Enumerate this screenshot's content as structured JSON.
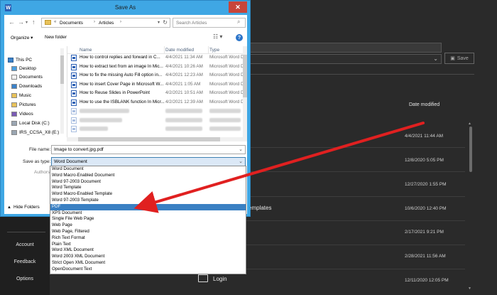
{
  "dialog": {
    "title": "Save As",
    "close_icon": "close-icon",
    "breadcrumb": [
      "Documents",
      "Articles"
    ],
    "breadcrumb_prefix": "«",
    "search_placeholder": "Search Articles",
    "toolbar": {
      "organize": "Organize ▾",
      "new_folder": "New folder",
      "help": "?"
    },
    "nav": [
      {
        "label": "This PC",
        "icon": "pc-icon"
      },
      {
        "label": "Desktop",
        "icon": "folder-icon"
      },
      {
        "label": "Documents",
        "icon": "folder-icon"
      },
      {
        "label": "Downloads",
        "icon": "folder-icon"
      },
      {
        "label": "Music",
        "icon": "folder-icon"
      },
      {
        "label": "Pictures",
        "icon": "folder-icon"
      },
      {
        "label": "Videos",
        "icon": "folder-icon"
      },
      {
        "label": "Local Disk (C:)",
        "icon": "disk-icon"
      },
      {
        "label": "IRS_CCSA_X8 (E:)",
        "icon": "disk-icon"
      }
    ],
    "columns": {
      "name": "Name",
      "date": "Date modified",
      "type": "Type"
    },
    "files": [
      {
        "name": "How to control replies and forward in C...",
        "date": "4/4/2021 11:34 AM",
        "type": "Microsoft Word D"
      },
      {
        "name": "How to extract text from an image In Mic...",
        "date": "4/4/2021 10:26 AM",
        "type": "Microsoft Word D"
      },
      {
        "name": "How to fix the missing Auto Fill option in...",
        "date": "4/4/2021 12:23 AM",
        "type": "Microsoft Word D"
      },
      {
        "name": "How to insert Cover Page in Microsoft W...",
        "date": "4/4/2021 1:05 AM",
        "type": "Microsoft Word D"
      },
      {
        "name": "How to Reuse Slides in PowerPoint",
        "date": "4/2/2021 10:51 AM",
        "type": "Microsoft Word D"
      },
      {
        "name": "How to use the ISBLANK function In Micr...",
        "date": "4/2/2021 12:39 AM",
        "type": "Microsoft Word D"
      }
    ],
    "file_name_label": "File name:",
    "file_name_value": "Image to convert.jpg.pdf",
    "save_as_type_label": "Save as type:",
    "save_as_type_value": "Word Document",
    "authors_label": "Authors:",
    "hide_folders": "Hide Folders",
    "type_options": [
      "Word Document",
      "Word Macro-Enabled Document",
      "Word 97-2003 Document",
      "Word Template",
      "Word Macro-Enabled Template",
      "Word 97-2003 Template",
      "PDF",
      "XPS Document",
      "Single File Web Page",
      "Web Page",
      "Web Page, Filtered",
      "Rich Text Format",
      "Plain Text",
      "Word XML Document",
      "Word 2003 XML Document",
      "Strict Open XML Document",
      "OpenDocument Text"
    ],
    "selected_option": "PDF"
  },
  "backstage": {
    "nav": [
      "Account",
      "Feedback",
      "Options"
    ],
    "save_button": "Save",
    "column_header": "Date modified",
    "partial_labels": [
      "a",
      "Templates"
    ],
    "dates": [
      "4/4/2021 11:44 AM",
      "12/8/2020 5:05 PM",
      "12/27/2020 1:55 PM",
      "10/6/2020 12:40 PM",
      "2/17/2021 9:21 PM",
      "2/28/2021 11:56 AM",
      "12/11/2020 12:05 PM"
    ],
    "login": "Login"
  },
  "colors": {
    "dialog_frame": "#3fa7e4",
    "selection": "#3a80c3",
    "arrow": "#e02020",
    "backstage_bg": "#2a2a2a"
  }
}
